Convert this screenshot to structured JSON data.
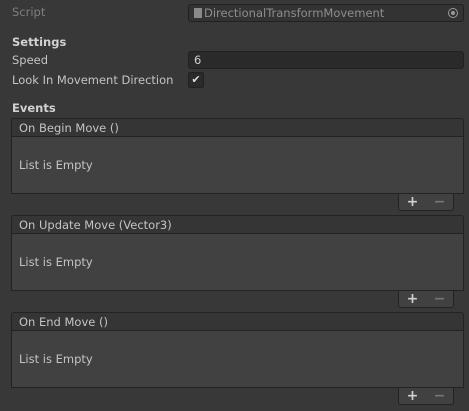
{
  "script": {
    "label": "Script",
    "value": "DirectionalTransformMovement"
  },
  "settings": {
    "header": "Settings",
    "speed_label": "Speed",
    "speed_value": "6",
    "look_label": "Look In Movement Direction",
    "look_checked": true,
    "check_glyph": "✔"
  },
  "events": {
    "header": "Events",
    "items": [
      {
        "title": "On Begin Move ()",
        "body": "List is Empty"
      },
      {
        "title": "On Update Move (Vector3)",
        "body": "List is Empty"
      },
      {
        "title": "On End Move ()",
        "body": "List is Empty"
      }
    ],
    "plus": "+",
    "minus": "−"
  }
}
